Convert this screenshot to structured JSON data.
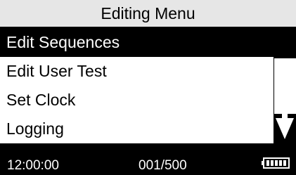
{
  "title": "Editing Menu",
  "menu": {
    "items": [
      {
        "label": "Edit Sequences",
        "selected": true
      },
      {
        "label": "Edit User Test",
        "selected": false
      },
      {
        "label": "Set Clock",
        "selected": false
      },
      {
        "label": "Logging",
        "selected": false
      }
    ]
  },
  "scrollbar": {
    "icon": "arrow-down-icon"
  },
  "status": {
    "time": "12:00:00",
    "count": "001/500",
    "battery_icon": "battery-icon",
    "battery_level": 1.0
  },
  "colors": {
    "background": "#000000",
    "title_bar": "#e6e6e6",
    "menu_background": "#ffffff",
    "selected_background": "#000000",
    "selected_text": "#ffffff"
  }
}
